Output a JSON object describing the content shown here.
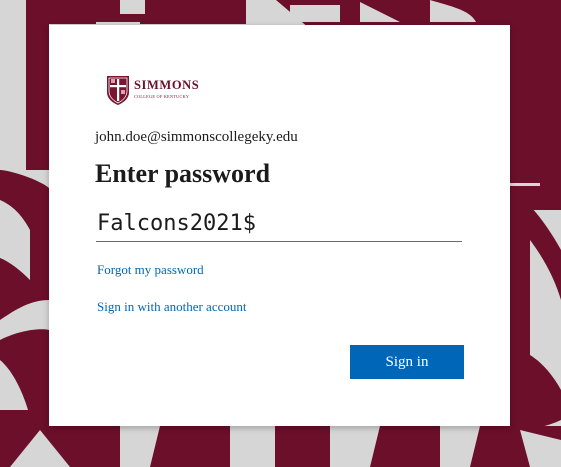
{
  "org": {
    "logo_name": "SIMMONS",
    "logo_tagline": "COLLEGE OF KENTUCKY"
  },
  "signin": {
    "identity": "john.doe@simmonscollegeky.edu",
    "heading": "Enter password",
    "password_value": "Falcons2021$",
    "forgot_link": "Forgot my password",
    "other_account_link": "Sign in with another account",
    "submit_label": "Sign in"
  },
  "colors": {
    "brand_maroon": "#6b0f2b",
    "accent_blue": "#0067b8",
    "background_gray": "#d6d6d6"
  }
}
